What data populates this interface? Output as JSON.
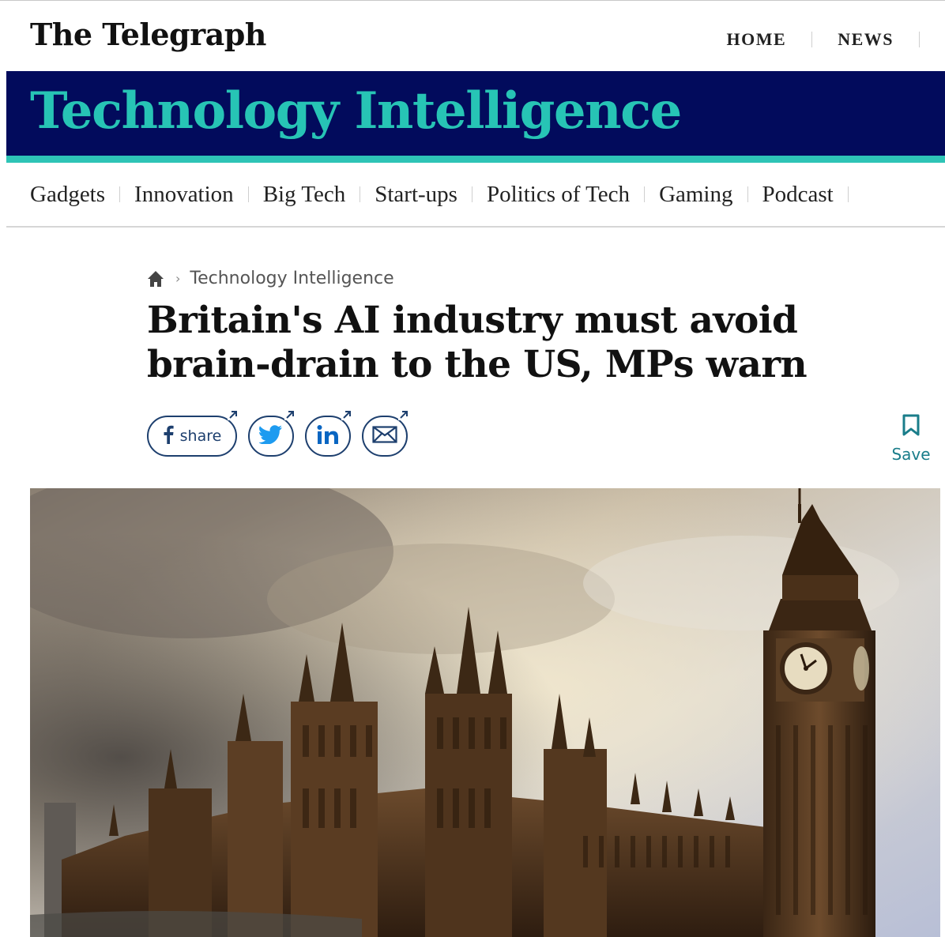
{
  "masthead": {
    "logo": "The Telegraph",
    "nav": [
      "HOME",
      "NEWS"
    ]
  },
  "banner": {
    "title": "Technology Intelligence"
  },
  "section_nav": {
    "items": [
      "Gadgets",
      "Innovation",
      "Big Tech",
      "Start-ups",
      "Politics of Tech",
      "Gaming",
      "Podcast"
    ]
  },
  "breadcrumb": {
    "icon": "home-icon",
    "section": "Technology Intelligence"
  },
  "article": {
    "headline": "Britain's AI industry must avoid brain-drain to the US, MPs warn"
  },
  "share": {
    "facebook_label": "share",
    "icons": [
      "facebook-icon",
      "twitter-icon",
      "linkedin-icon",
      "email-icon"
    ]
  },
  "save": {
    "label": "Save",
    "icon": "bookmark-icon"
  },
  "colors": {
    "banner_bg": "#020b5c",
    "banner_text": "#27c4b5",
    "accent": "#2ec4b6",
    "save_color": "#1a7d8a",
    "share_border": "#1d3f6e"
  }
}
